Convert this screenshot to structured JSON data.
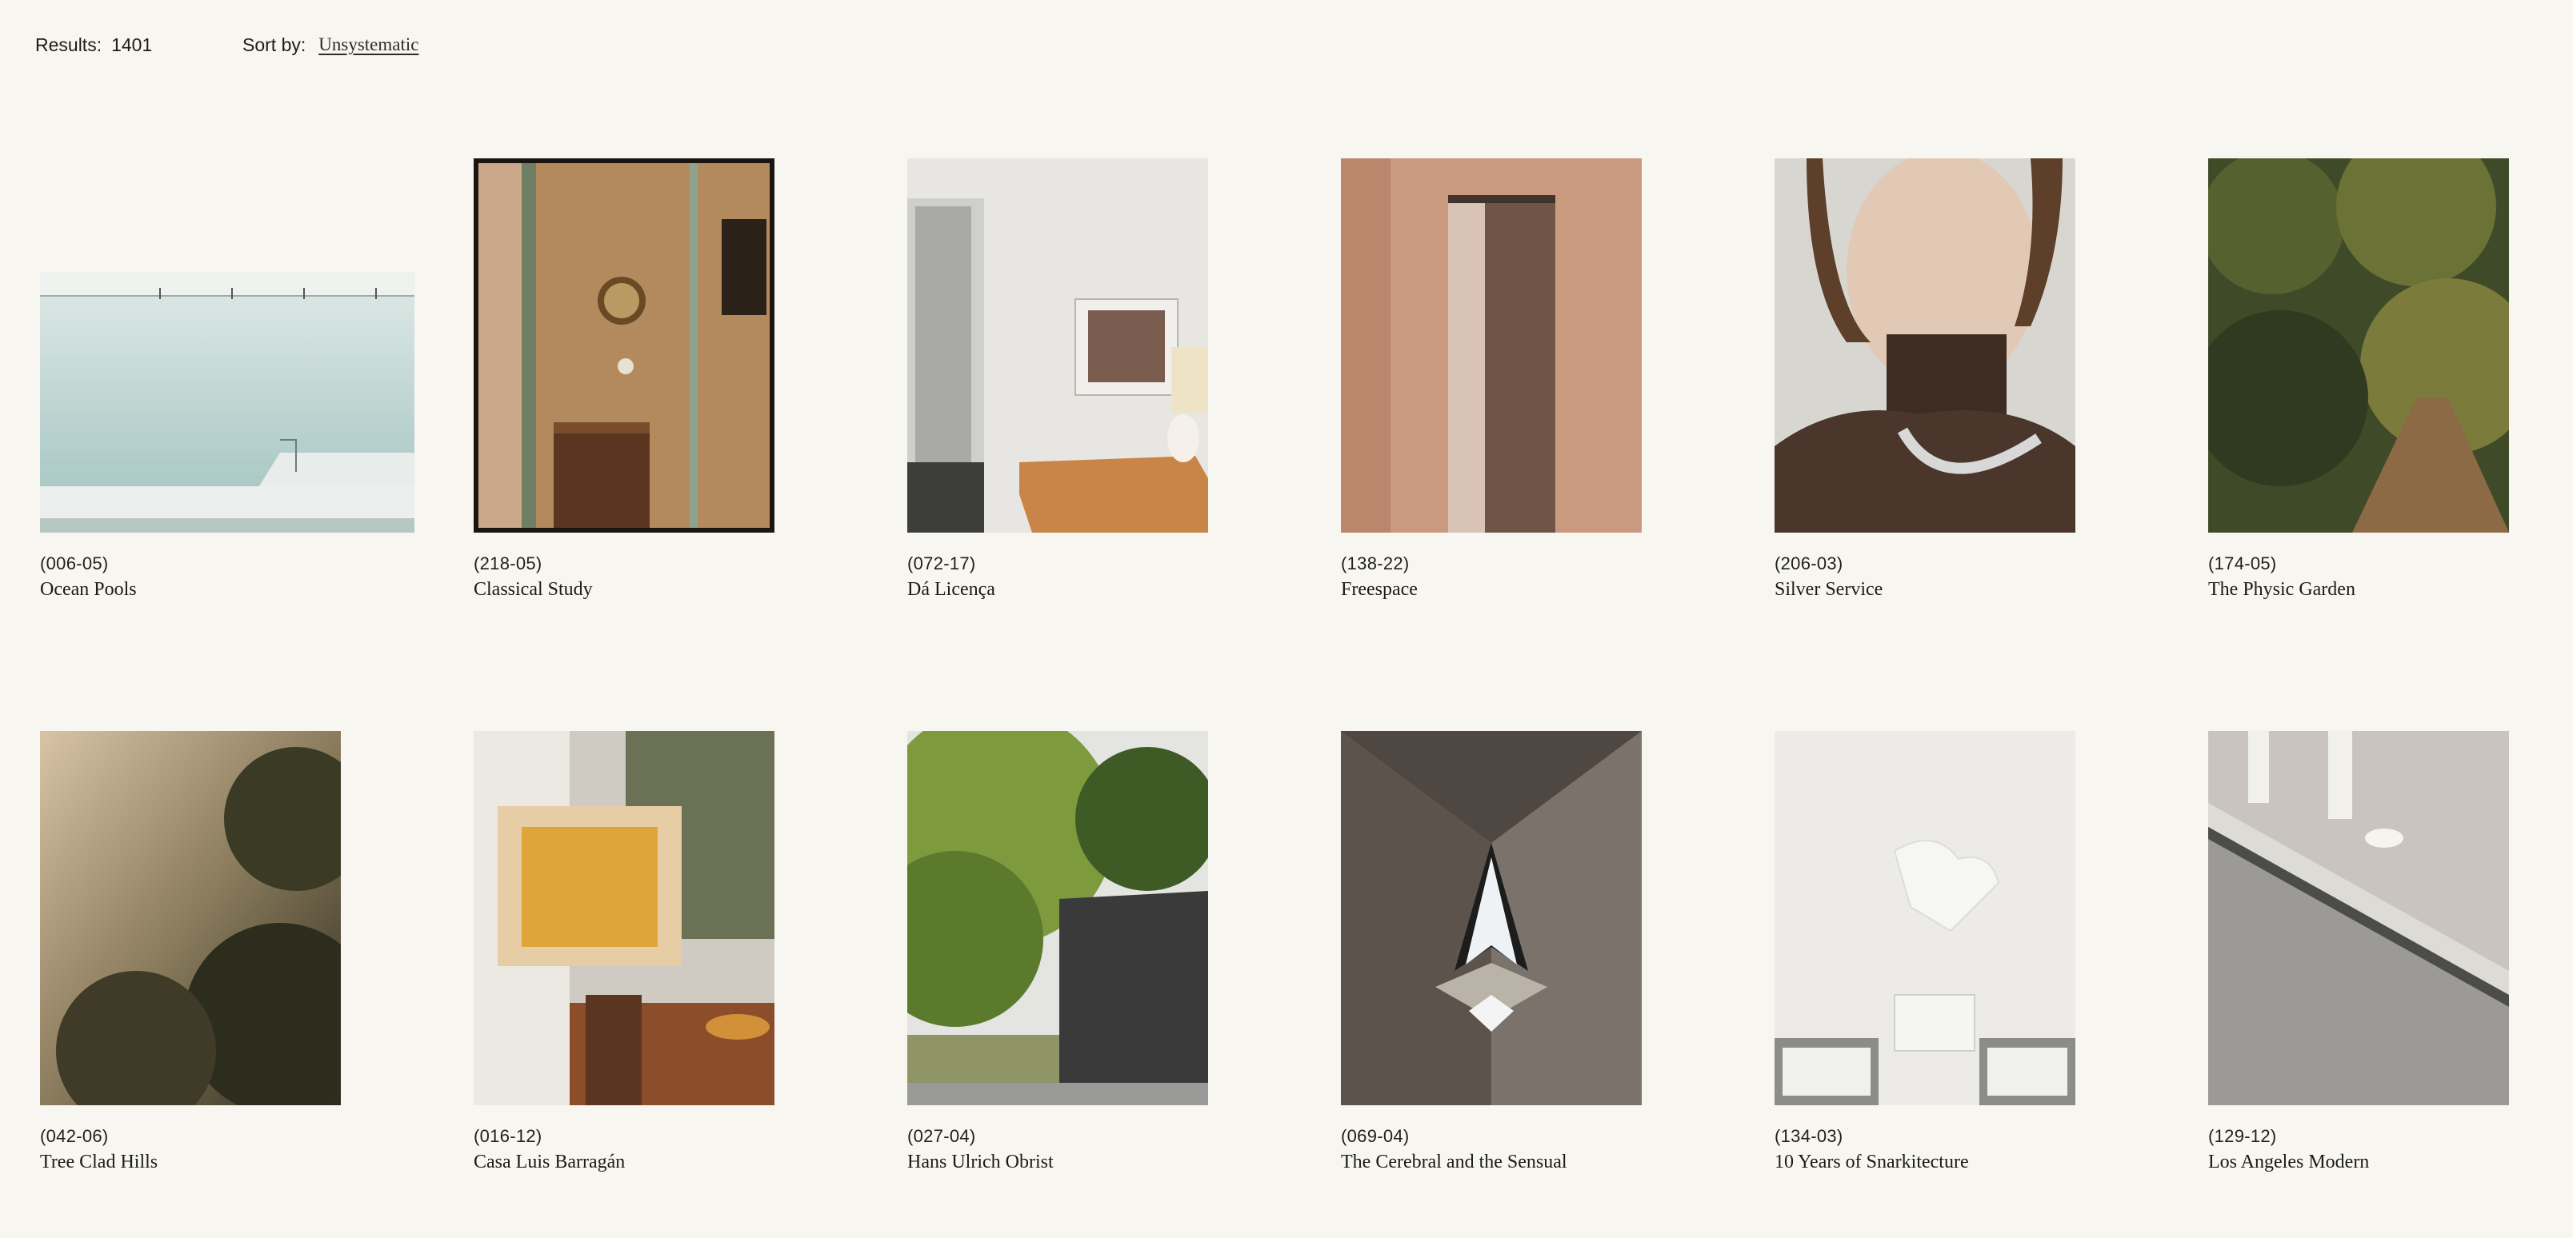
{
  "header": {
    "results_label": "Results:",
    "results_count": "1401",
    "sort_label": "Sort by:",
    "sort_value": "Unsystematic"
  },
  "items": [
    {
      "code": "(006-05)",
      "title": "Ocean Pools"
    },
    {
      "code": "(218-05)",
      "title": "Classical Study"
    },
    {
      "code": "(072-17)",
      "title": "Dá Licença"
    },
    {
      "code": "(138-22)",
      "title": "Freespace"
    },
    {
      "code": "(206-03)",
      "title": "Silver Service"
    },
    {
      "code": "(174-05)",
      "title": "The Physic Garden"
    },
    {
      "code": "(042-06)",
      "title": "Tree Clad Hills"
    },
    {
      "code": "(016-12)",
      "title": "Casa Luis Barragán"
    },
    {
      "code": "(027-04)",
      "title": "Hans Ulrich Obrist"
    },
    {
      "code": "(069-04)",
      "title": "The Cerebral and the Sensual"
    },
    {
      "code": "(134-03)",
      "title": "10 Years of Snarkitecture"
    },
    {
      "code": "(129-12)",
      "title": "Los Angeles Modern"
    }
  ]
}
